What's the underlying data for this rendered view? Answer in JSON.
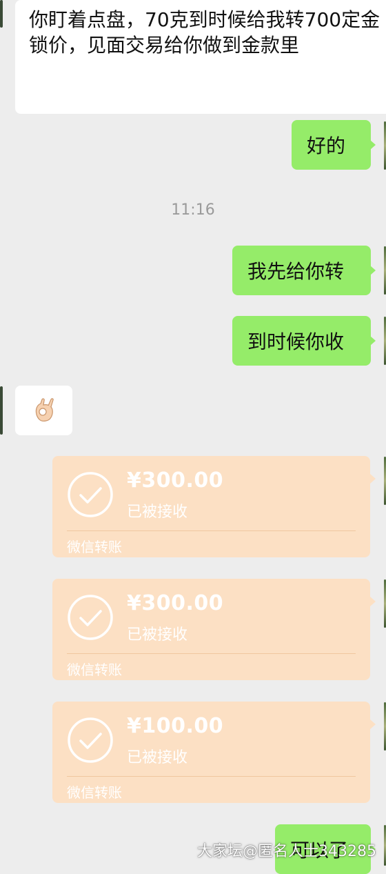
{
  "messages": {
    "m1": "你盯着点盘，70克到时候给我转700定金锁价，见面交易给你做到金款里",
    "m2": "好的",
    "time": "11:16",
    "m3": "我先给你转",
    "m4": "到时候你收",
    "m5_icon": "ok-hand-emoji",
    "m9": "可以了"
  },
  "transfers": [
    {
      "amount": "¥300.00",
      "status": "已被接收",
      "label": "微信转账"
    },
    {
      "amount": "¥300.00",
      "status": "已被接收",
      "label": "微信转账"
    },
    {
      "amount": "¥100.00",
      "status": "已被接收",
      "label": "微信转账"
    }
  ],
  "watermark": "大家坛@匿名人士343285",
  "colors": {
    "background": "#ededed",
    "incoming_bubble": "#ffffff",
    "outgoing_bubble": "#95ec69",
    "transfer_card": "#fce0c4"
  }
}
